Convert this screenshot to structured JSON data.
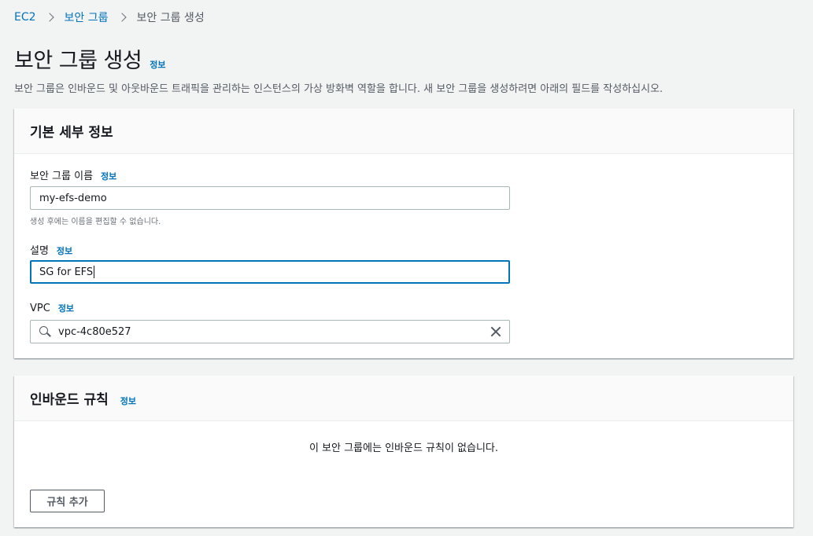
{
  "breadcrumb": {
    "items": [
      "EC2",
      "보안 그룹"
    ],
    "current": "보안 그룹 생성"
  },
  "header": {
    "title": "보안 그룹 생성",
    "info_label": "정보",
    "description": "보안 그룹은 인바운드 및 아웃바운드 트래픽을 관리하는 인스턴스의 가상 방화벽 역할을 합니다. 새 보안 그룹을 생성하려면 아래의 필드를 작성하십시오."
  },
  "basic_details": {
    "title": "기본 세부 정보",
    "name_field": {
      "label": "보안 그룹 이름",
      "info_label": "정보",
      "value": "my-efs-demo",
      "hint": "생성 후에는 이름을 편집할 수 없습니다."
    },
    "description_field": {
      "label": "설명",
      "info_label": "정보",
      "value": "SG for EFS"
    },
    "vpc_field": {
      "label": "VPC",
      "info_label": "정보",
      "value": "vpc-4c80e527"
    }
  },
  "inbound_rules": {
    "title": "인바운드 규칙",
    "info_label": "정보",
    "empty_message": "이 보안 그룹에는 인바운드 규칙이 없습니다.",
    "add_rule_label": "규칙 추가"
  },
  "colors": {
    "link": "#0073bb",
    "background": "#f2f3f3",
    "focus_border": "#0073bb"
  }
}
